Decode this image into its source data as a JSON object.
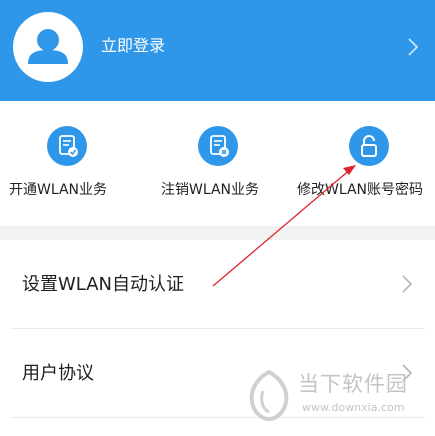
{
  "header": {
    "login_label": "立即登录",
    "accent_color": "#2f97ea",
    "icons": {
      "avatar": "user-avatar-icon",
      "chevron": "chevron-right-icon"
    }
  },
  "quick_actions": [
    {
      "label": "开通WLAN业务",
      "icon": "document-check-icon"
    },
    {
      "label": "注销WLAN业务",
      "icon": "document-cancel-icon"
    },
    {
      "label": "修改WLAN账号密码",
      "icon": "lock-icon"
    }
  ],
  "list": [
    {
      "label": "设置WLAN自动认证",
      "icon": "chevron-right-icon"
    },
    {
      "label": "用户协议",
      "icon": "chevron-right-icon"
    }
  ],
  "annotation": {
    "color": "#e0202a",
    "type": "arrow"
  },
  "watermark": {
    "title": "当下软件园",
    "url": "www.downxia.com",
    "color": "#c4c4c4"
  }
}
